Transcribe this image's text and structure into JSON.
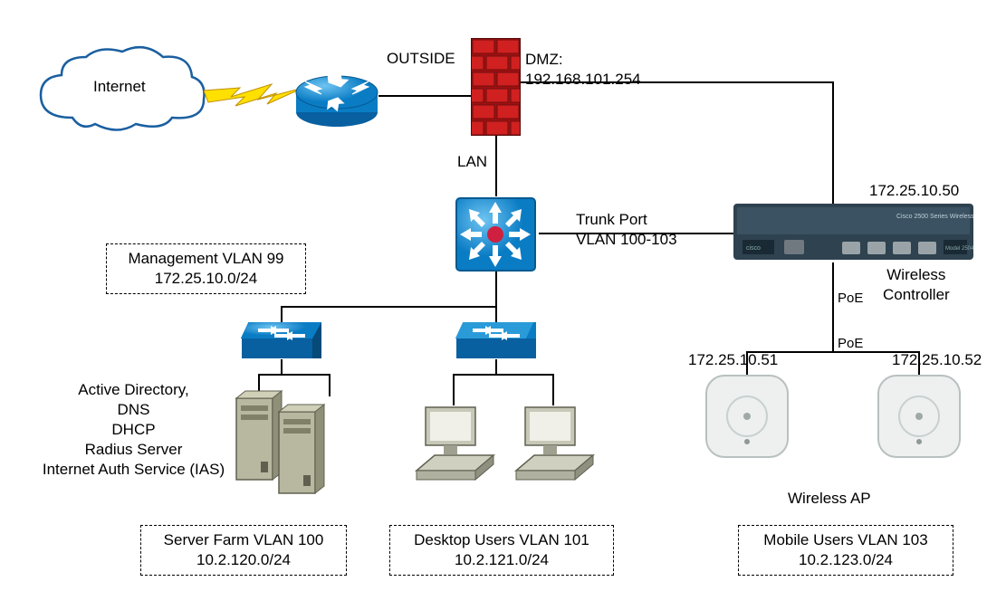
{
  "labels": {
    "internet": "Internet",
    "outside": "OUTSIDE",
    "dmz": "DMZ:\n192.168.101.254",
    "lan": "LAN",
    "wlc_ip": "172.25.10.50",
    "wlc_name": "Wireless\nController",
    "trunk": "Trunk Port\nVLAN 100-103",
    "poe1": "PoE",
    "poe2": "PoE",
    "ap1_ip": "172.25.10.51",
    "ap2_ip": "172.25.10.52",
    "ap_name": "Wireless AP",
    "services": "Active Directory,\nDNS\nDHCP\nRadius Server\nInternet Auth Service (IAS)"
  },
  "boxes": {
    "mgmt": {
      "line1": "Management VLAN 99",
      "line2": "172.25.10.0/24"
    },
    "server": {
      "line1": "Server Farm VLAN 100",
      "line2": "10.2.120.0/24"
    },
    "desktop": {
      "line1": "Desktop Users VLAN 101",
      "line2": "10.2.121.0/24"
    },
    "mobile": {
      "line1": "Mobile Users VLAN 103",
      "line2": "10.2.123.0/24"
    }
  }
}
